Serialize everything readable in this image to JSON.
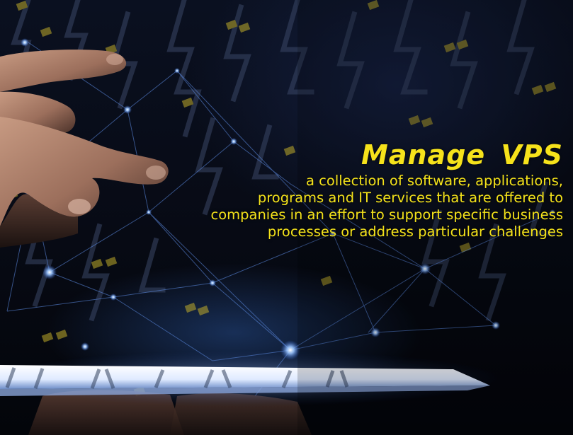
{
  "hero": {
    "title": "Manage  VPS",
    "description_lines": [
      "a collection of software, applications,",
      "programs and IT services that are offered to",
      "companies in an effort to support specific business",
      "processes or address particular challenges"
    ]
  },
  "colors": {
    "accent": "#f6e21b",
    "glow": "#7fb0ff",
    "background": "#05070d"
  },
  "imagery": [
    "hand-illustration",
    "tablet-illustration",
    "network-lines",
    "circuit-pattern"
  ]
}
